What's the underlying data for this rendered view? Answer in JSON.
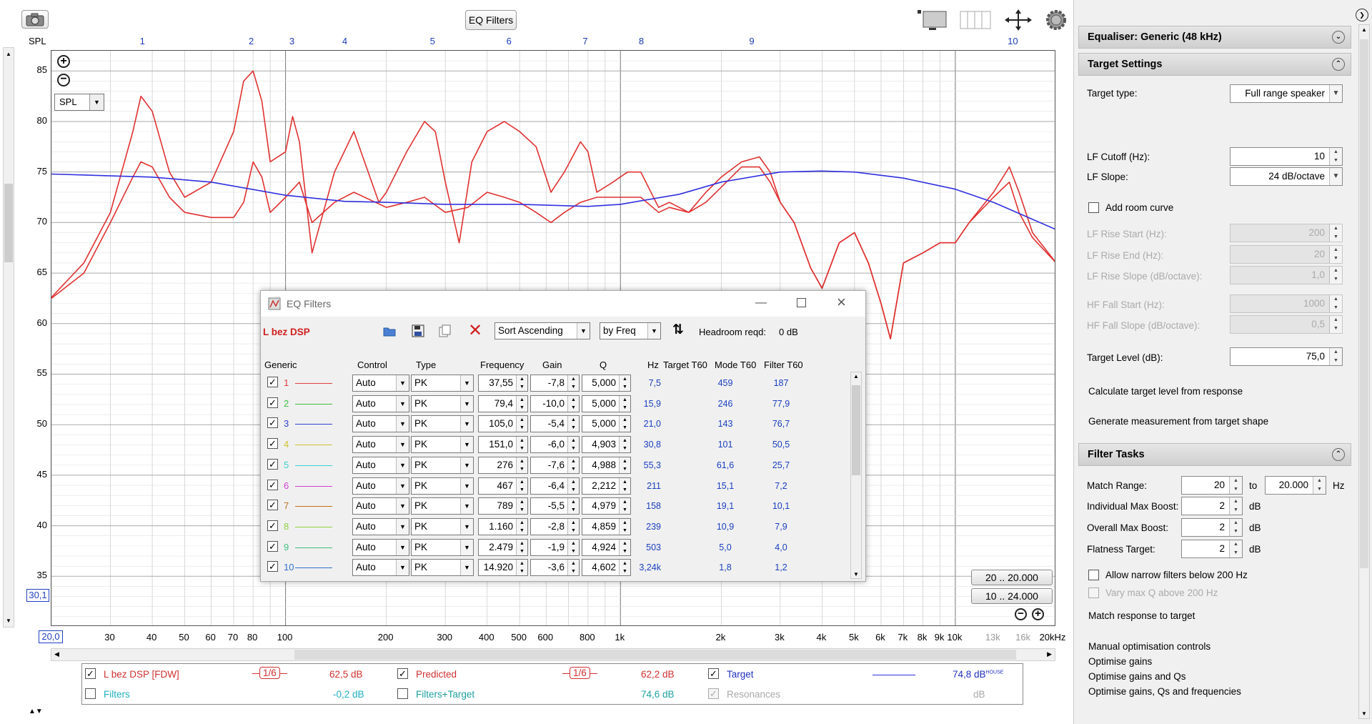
{
  "toolbar": {
    "eq_filters_button": "EQ Filters",
    "spl_label": "SPL"
  },
  "graph": {
    "filter_markers": [
      "1",
      "2",
      "3",
      "4",
      "5",
      "6",
      "7",
      "8",
      "9",
      "10"
    ],
    "y_ticks": [
      "85",
      "80",
      "75",
      "70",
      "65",
      "60",
      "55",
      "50",
      "45",
      "40",
      "35"
    ],
    "y_readout": "30,1",
    "x_readout": "20,0",
    "x_ticks": [
      "30",
      "40",
      "50",
      "60",
      "70",
      "80",
      "100",
      "200",
      "300",
      "400",
      "500",
      "600",
      "800",
      "1k",
      "2k",
      "3k",
      "4k",
      "5k",
      "6k",
      "7k",
      "8k",
      "9k",
      "10k",
      "13k",
      "16k",
      "20kHz"
    ],
    "spl_dropdown": "SPL",
    "range_button_1": "20 .. 20.000",
    "range_button_2": "10 .. 24.000"
  },
  "chart_data": {
    "type": "line",
    "xlabel": "",
    "ylabel": "SPL",
    "x_scale": "log",
    "xlim": [
      20,
      20000
    ],
    "ylim": [
      30,
      87
    ],
    "series": [
      {
        "name": "L bez DSP [FDW]",
        "color": "#e03030",
        "x": [
          20,
          25,
          30,
          35,
          37,
          40,
          45,
          50,
          60,
          70,
          75,
          80,
          85,
          90,
          100,
          105,
          110,
          120,
          140,
          160,
          190,
          200,
          230,
          260,
          280,
          300,
          330,
          360,
          400,
          450,
          500,
          560,
          620,
          680,
          760,
          800,
          850,
          950,
          1050,
          1150,
          1300,
          1400,
          1600,
          1800,
          2000,
          2300,
          2600,
          2800,
          3000,
          3300,
          3700,
          4000,
          4500,
          5000,
          5500,
          6000,
          6400,
          7000,
          8000,
          9000,
          10000,
          11000,
          13000,
          14500,
          15500,
          17000,
          20000
        ],
        "y": [
          62.6,
          66,
          71,
          79,
          82.5,
          81,
          75,
          72.5,
          74,
          79,
          84,
          85,
          82,
          76,
          77,
          80.5,
          78,
          67,
          75,
          79,
          72,
          73,
          77,
          80,
          79,
          74,
          68,
          76,
          79,
          80,
          79,
          77.5,
          73,
          75,
          78,
          77,
          73,
          74,
          75,
          75,
          71.5,
          72,
          71,
          73,
          74.5,
          76,
          76.5,
          75,
          72,
          70,
          65.5,
          63.5,
          68,
          69,
          66,
          62,
          58.5,
          66,
          67,
          68,
          68,
          70,
          73,
          75.5,
          73,
          69,
          66
        ]
      },
      {
        "name": "Predicted",
        "color": "#e03030",
        "x": [
          20,
          25,
          30,
          35,
          37,
          40,
          45,
          50,
          60,
          70,
          75,
          80,
          85,
          90,
          100,
          110,
          120,
          140,
          160,
          200,
          230,
          260,
          300,
          350,
          400,
          450,
          500,
          560,
          620,
          680,
          760,
          850,
          950,
          1050,
          1150,
          1300,
          1400,
          1600,
          1800,
          2000,
          2300,
          2600,
          2800,
          3000,
          3300,
          3700,
          4000,
          4500,
          5000,
          5500,
          6000,
          6400,
          7000,
          8000,
          9000,
          10000,
          11000,
          13000,
          14500,
          15500,
          17000,
          20000
        ],
        "y": [
          62.5,
          65,
          70,
          74.5,
          76,
          75.5,
          72.5,
          71,
          70.5,
          70.5,
          72,
          76,
          74.5,
          71,
          72.5,
          74,
          70,
          72,
          73,
          71.5,
          72,
          72.5,
          71,
          71.5,
          73,
          72.5,
          72,
          71,
          70,
          71,
          72,
          72.5,
          72.5,
          72.5,
          72.5,
          71,
          71.5,
          71,
          72,
          73.5,
          75.5,
          75.5,
          74,
          72,
          70,
          65.5,
          63.5,
          68,
          69,
          66,
          62,
          58.5,
          66,
          67,
          68,
          68,
          70,
          72.5,
          74,
          71,
          68.5,
          66
        ]
      },
      {
        "name": "Target",
        "color": "#3030e0",
        "x": [
          20,
          40,
          60,
          100,
          150,
          200,
          300,
          500,
          800,
          1000,
          1500,
          2000,
          3000,
          4000,
          5000,
          7000,
          10000,
          13000,
          16000,
          20000
        ],
        "y": [
          74.8,
          74.5,
          74,
          72.7,
          72.1,
          72,
          71.8,
          71.8,
          71.6,
          71.8,
          72.8,
          74,
          75,
          75.1,
          75,
          74.4,
          73.3,
          72,
          70.7,
          69.3
        ]
      }
    ]
  },
  "legend": {
    "row1": [
      {
        "label": "L bez DSP [FDW]",
        "smoothing": "1/6",
        "level": "62,5 dB"
      },
      {
        "label": "Predicted",
        "smoothing": "1/6",
        "level": "62,2 dB"
      },
      {
        "label": "Target",
        "level": "74,8 dB",
        "sup": "HOUSE"
      }
    ],
    "row2": [
      {
        "label": "Filters",
        "level": "-0,2 dB"
      },
      {
        "label": "Filters+Target",
        "level": "74,6 dB"
      },
      {
        "label": "Resonances",
        "level": "dB"
      }
    ]
  },
  "eq_window": {
    "title": "EQ Filters",
    "config_name": "L bez DSP",
    "sort_order": "Sort Ascending",
    "sort_by": "by Freq",
    "headroom_label": "Headroom reqd:",
    "headroom_value": "0 dB",
    "columns": {
      "generic": "Generic",
      "control": "Control",
      "type": "Type",
      "frequency": "Frequency",
      "gain": "Gain",
      "q": "Q",
      "hz": "Hz",
      "target_t60": "Target T60",
      "mode_t60": "Mode T60",
      "filter_t60": "Filter T60"
    },
    "filters": [
      {
        "num": "1",
        "color": "#e04040",
        "control": "Auto",
        "type": "PK",
        "freq": "37,55",
        "gain": "-7,8",
        "q": "5,000",
        "hz": "7,5",
        "target": "",
        "mode": "459",
        "filter": "187"
      },
      {
        "num": "2",
        "color": "#40c040",
        "control": "Auto",
        "type": "PK",
        "freq": "79,4",
        "gain": "-10,0",
        "q": "5,000",
        "hz": "15,9",
        "target": "",
        "mode": "246",
        "filter": "77,9"
      },
      {
        "num": "3",
        "color": "#3040d0",
        "control": "Auto",
        "type": "PK",
        "freq": "105,0",
        "gain": "-5,4",
        "q": "5,000",
        "hz": "21,0",
        "target": "",
        "mode": "143",
        "filter": "76,7"
      },
      {
        "num": "4",
        "color": "#d0c030",
        "control": "Auto",
        "type": "PK",
        "freq": "151,0",
        "gain": "-6,0",
        "q": "4,903",
        "hz": "30,8",
        "target": "",
        "mode": "101",
        "filter": "50,5"
      },
      {
        "num": "5",
        "color": "#40d0d0",
        "control": "Auto",
        "type": "PK",
        "freq": "276",
        "gain": "-7,6",
        "q": "4,988",
        "hz": "55,3",
        "target": "",
        "mode": "61,6",
        "filter": "25,7"
      },
      {
        "num": "6",
        "color": "#d040d0",
        "control": "Auto",
        "type": "PK",
        "freq": "467",
        "gain": "-6,4",
        "q": "2,212",
        "hz": "211",
        "target": "",
        "mode": "15,1",
        "filter": "7,2"
      },
      {
        "num": "7",
        "color": "#c07020",
        "control": "Auto",
        "type": "PK",
        "freq": "789",
        "gain": "-5,5",
        "q": "4,979",
        "hz": "158",
        "target": "",
        "mode": "19,1",
        "filter": "10,1"
      },
      {
        "num": "8",
        "color": "#90d040",
        "control": "Auto",
        "type": "PK",
        "freq": "1.160",
        "gain": "-2,8",
        "q": "4,859",
        "hz": "239",
        "target": "",
        "mode": "10,9",
        "filter": "7,9"
      },
      {
        "num": "9",
        "color": "#40c080",
        "control": "Auto",
        "type": "PK",
        "freq": "2.479",
        "gain": "-1,9",
        "q": "4,924",
        "hz": "503",
        "target": "",
        "mode": "5,0",
        "filter": "4,0"
      },
      {
        "num": "10",
        "color": "#3070d0",
        "control": "Auto",
        "type": "PK",
        "freq": "14.920",
        "gain": "-3,6",
        "q": "4,602",
        "hz": "3,24k",
        "target": "",
        "mode": "1,8",
        "filter": "1,2"
      }
    ]
  },
  "right_panel": {
    "equaliser_header": "Equaliser: Generic (48 kHz)",
    "target_settings_header": "Target Settings",
    "target_type_label": "Target type:",
    "target_type_value": "Full range speaker",
    "lf_cutoff_label": "LF Cutoff (Hz):",
    "lf_cutoff_value": "10",
    "lf_slope_label": "LF Slope:",
    "lf_slope_value": "24 dB/octave",
    "add_room_curve": "Add room curve",
    "lf_rise_start_label": "LF Rise Start (Hz):",
    "lf_rise_start_value": "200",
    "lf_rise_end_label": "LF Rise End (Hz):",
    "lf_rise_end_value": "20",
    "lf_rise_slope_label": "LF Rise Slope (dB/octave):",
    "lf_rise_slope_value": "1,0",
    "hf_fall_start_label": "HF Fall Start (Hz):",
    "hf_fall_start_value": "1000",
    "hf_fall_slope_label": "HF Fall Slope (dB/octave):",
    "hf_fall_slope_value": "0,5",
    "target_level_label": "Target Level (dB):",
    "target_level_value": "75,0",
    "calc_target_level": "Calculate target level from response",
    "generate_measurement": "Generate measurement from target shape",
    "filter_tasks_header": "Filter Tasks",
    "match_range_label": "Match Range:",
    "match_range_from": "20",
    "match_range_to_label": "to",
    "match_range_to": "20.000",
    "match_range_unit": "Hz",
    "ind_max_boost_label": "Individual Max Boost:",
    "ind_max_boost_value": "2",
    "overall_max_boost_label": "Overall Max Boost:",
    "overall_max_boost_value": "2",
    "flatness_target_label": "Flatness Target:",
    "flatness_target_value": "2",
    "db_unit": "dB",
    "allow_narrow": "Allow narrow filters below 200 Hz",
    "vary_max_q": "Vary max Q above 200 Hz",
    "match_response": "Match response to target",
    "manual_opt": "Manual optimisation controls",
    "opt_gains": "Optimise gains",
    "opt_gains_qs": "Optimise gains and Qs",
    "opt_gains_qs_freqs": "Optimise gains, Qs and frequencies"
  }
}
